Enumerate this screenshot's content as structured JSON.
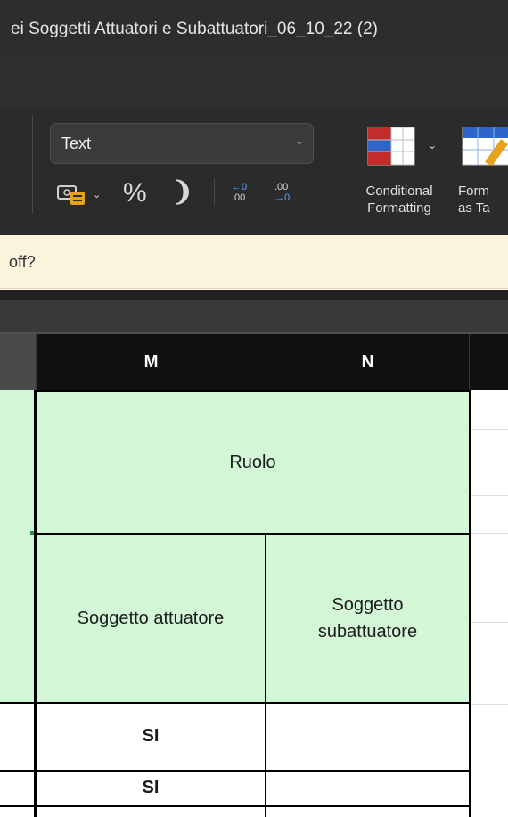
{
  "window": {
    "title": "ei Soggetti Attuatori e Subattuatori_06_10_22 (2)"
  },
  "ribbon": {
    "number_format": {
      "selected": "Text",
      "options": [
        "Text"
      ]
    },
    "percent_label": "%",
    "comma_label": "❩",
    "increase_decimal": {
      "top": "←0",
      "bottom": ".00"
    },
    "decrease_decimal": {
      "top": ".00",
      "bottom": "→0"
    },
    "conditional_formatting": {
      "line1": "Conditional",
      "line2": "Formatting"
    },
    "format_as_table": {
      "line1": "Form",
      "line2": "as Ta"
    },
    "icons": [
      "currency-format-icon",
      "conditional-formatting-icon",
      "format-as-table-icon"
    ]
  },
  "message_bar": {
    "text": "off?"
  },
  "columns": [
    "M",
    "N"
  ],
  "sheet": {
    "header_merged": "Ruolo",
    "subheaders": [
      "Soggetto attuatore",
      "Soggetto subattuatore"
    ],
    "rows": [
      {
        "M": "SI",
        "N": ""
      },
      {
        "M": "SI",
        "N": ""
      }
    ]
  },
  "colors": {
    "header_fill": "#d2f6d6",
    "ribbon_bg": "#2b2b2b",
    "message_bar_bg": "#fcf3dc",
    "accent_blue": "#5aa9ff",
    "cf_red": "#c42b2b"
  }
}
